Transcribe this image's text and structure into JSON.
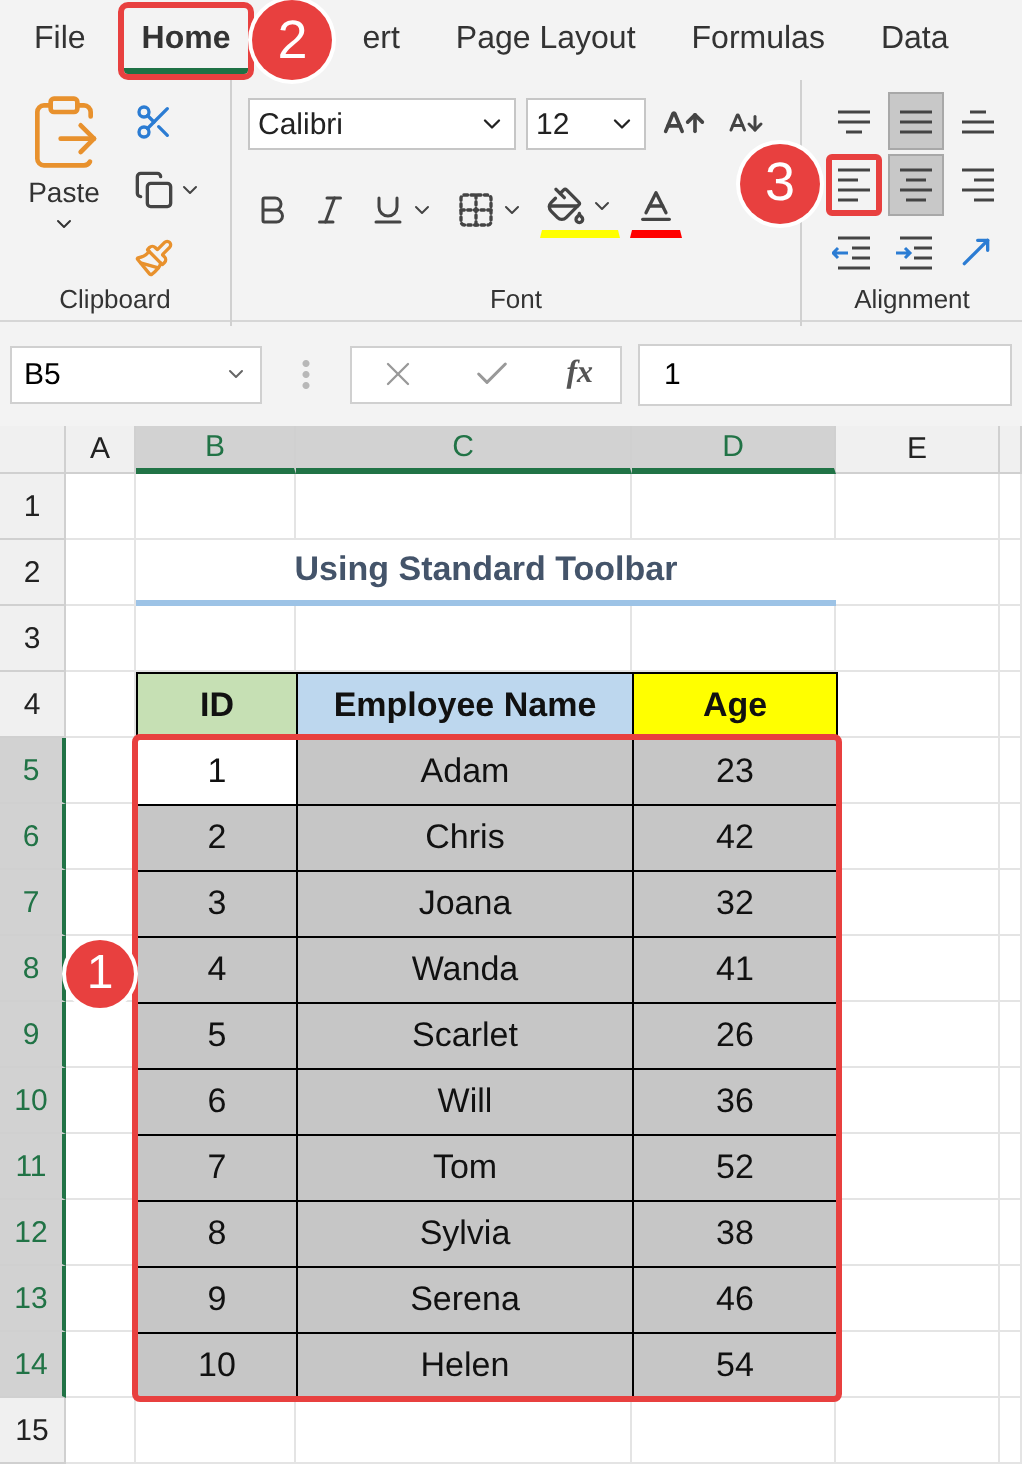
{
  "ribbon": {
    "tabs": [
      {
        "label": "File",
        "selected": false
      },
      {
        "label": "Home",
        "selected": true,
        "badge": "2"
      },
      {
        "label": "ert",
        "selected": false
      },
      {
        "label": "Page Layout",
        "selected": false
      },
      {
        "label": "Formulas",
        "selected": false
      },
      {
        "label": "Data",
        "selected": false
      }
    ],
    "clipboard": {
      "paste_label": "Paste",
      "group_label": "Clipboard"
    },
    "font": {
      "name": "Calibri",
      "size": "12",
      "group_label": "Font"
    },
    "alignment": {
      "group_label": "Alignment",
      "buttons": [
        {
          "kind": "top",
          "selected": false
        },
        {
          "kind": "middle",
          "selected": true
        },
        {
          "kind": "bottom",
          "selected": false
        },
        {
          "kind": "left",
          "selected": false,
          "badge": "3"
        },
        {
          "kind": "center",
          "selected": true
        },
        {
          "kind": "right",
          "selected": false
        },
        {
          "kind": "outdent",
          "selected": false
        },
        {
          "kind": "indent",
          "selected": false
        }
      ]
    }
  },
  "formula_bar": {
    "name_box": "B5",
    "fx_label": "fx",
    "value": "1"
  },
  "sheet": {
    "columns": [
      {
        "label": "A",
        "selected": false
      },
      {
        "label": "B",
        "selected": true
      },
      {
        "label": "C",
        "selected": true
      },
      {
        "label": "D",
        "selected": true
      },
      {
        "label": "E",
        "selected": false
      }
    ],
    "range_badge": "1",
    "rows": [
      {
        "number": "1",
        "selected": false
      },
      {
        "number": "2",
        "selected": false,
        "title": "Using Standard Toolbar"
      },
      {
        "number": "3",
        "selected": false
      },
      {
        "number": "4",
        "selected": false,
        "headers": [
          {
            "label": "ID",
            "color": "#c6e0b4"
          },
          {
            "label": "Employee Name",
            "color": "#bdd7ee"
          },
          {
            "label": "Age",
            "color": "#ffff00"
          }
        ]
      },
      {
        "number": "5",
        "selected": true,
        "active": true,
        "cells": [
          "1",
          "Adam",
          "23"
        ]
      },
      {
        "number": "6",
        "selected": true,
        "active": false,
        "cells": [
          "2",
          "Chris",
          "42"
        ]
      },
      {
        "number": "7",
        "selected": true,
        "active": false,
        "cells": [
          "3",
          "Joana",
          "32"
        ]
      },
      {
        "number": "8",
        "selected": true,
        "active": false,
        "cells": [
          "4",
          "Wanda",
          "41"
        ]
      },
      {
        "number": "9",
        "selected": true,
        "active": false,
        "cells": [
          "5",
          "Scarlet",
          "26"
        ]
      },
      {
        "number": "10",
        "selected": true,
        "active": false,
        "cells": [
          "6",
          "Will",
          "36"
        ]
      },
      {
        "number": "11",
        "selected": true,
        "active": false,
        "cells": [
          "7",
          "Tom",
          "52"
        ]
      },
      {
        "number": "12",
        "selected": true,
        "active": false,
        "cells": [
          "8",
          "Sylvia",
          "38"
        ]
      },
      {
        "number": "13",
        "selected": true,
        "active": false,
        "cells": [
          "9",
          "Serena",
          "46"
        ]
      },
      {
        "number": "14",
        "selected": true,
        "active": false,
        "cells": [
          "10",
          "Helen",
          "54"
        ]
      },
      {
        "number": "15",
        "selected": false
      }
    ]
  }
}
